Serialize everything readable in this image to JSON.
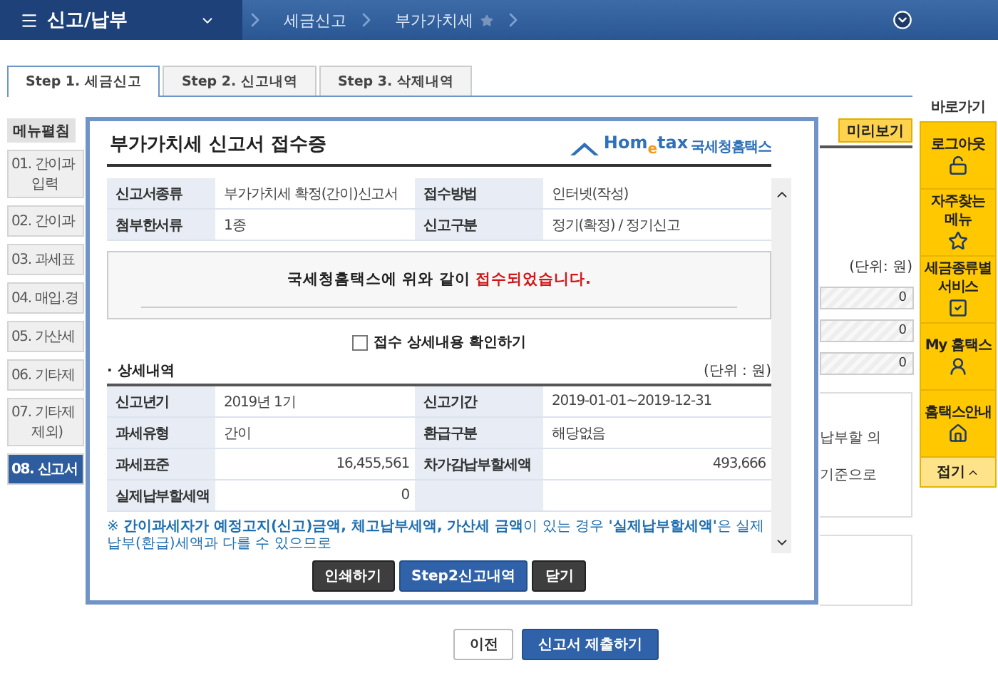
{
  "header": {
    "menu_title": "신고/납부",
    "breadcrumbs": [
      {
        "label": "세금신고"
      },
      {
        "label": "부가가치세",
        "starred": false
      }
    ]
  },
  "tabs": [
    {
      "label": "Step 1. 세금신고",
      "selected": true
    },
    {
      "label": "Step 2. 신고내역",
      "selected": false
    },
    {
      "label": "Step 3. 삭제내역",
      "selected": false
    }
  ],
  "side_menu": {
    "toggle": "메뉴펼침",
    "items": [
      {
        "lines": [
          "01. 간이과",
          "입력"
        ],
        "selected": false
      },
      {
        "lines": [
          "02. 간이과"
        ],
        "selected": false
      },
      {
        "lines": [
          "03. 과세표"
        ],
        "selected": false
      },
      {
        "lines": [
          "04. 매입.경"
        ],
        "selected": false
      },
      {
        "lines": [
          "05. 가산세"
        ],
        "selected": false
      },
      {
        "lines": [
          "06. 기타제"
        ],
        "selected": false
      },
      {
        "lines": [
          "07. 기타제",
          "제외)"
        ],
        "selected": false
      },
      {
        "lines": [
          "08. 신고서"
        ],
        "selected": true
      }
    ]
  },
  "right_panel": {
    "preview_button": "미리보기",
    "unit": "(단위: 원)",
    "fields": [
      {
        "value": "0"
      },
      {
        "value": "0"
      },
      {
        "value": "0"
      }
    ],
    "notes": [
      "납부할 의",
      "기준으로"
    ]
  },
  "quick_bar": {
    "title": "바로가기",
    "items": [
      {
        "lines": [
          "로그아웃"
        ]
      },
      {
        "lines": [
          "자주찾는",
          "메뉴"
        ]
      },
      {
        "lines": [
          "세금종류별",
          "서비스"
        ]
      },
      {
        "lines": [
          "My 홈택스"
        ]
      },
      {
        "lines": [
          "홈택스안내"
        ]
      }
    ],
    "collapse": "접기"
  },
  "dialog": {
    "title": "부가가치세 신고서 접수증",
    "logo": {
      "wordmark": "Hom$_{e}$tax",
      "name": "국세청홈택스"
    },
    "summary_rows": [
      [
        "신고서종류",
        "부가가치세 확정(간이)신고서",
        "접수방법",
        "인터넷(작성)"
      ],
      [
        "첨부한서류",
        "1종",
        "신고구분",
        "정기(확정) / 정기신고"
      ]
    ],
    "message": {
      "text": "국세청홈택스에 위와 같이 ",
      "highlight": "접수되었습니다."
    },
    "confirm_checkbox": {
      "label": "접수 상세내용 확인하기",
      "checked": false
    },
    "details": {
      "title": "· 상세내역",
      "unit": "(단위 : 원)",
      "rows": [
        [
          "신고년기",
          "2019년 1기",
          "신고기간",
          "2019-01-01~2019-12-31"
        ],
        [
          "과세유형",
          "간이",
          "환급구분",
          "해당없음"
        ],
        [
          "과세표준",
          "16,455,561",
          "차가감납부할세액",
          "493,666"
        ],
        [
          "실제납부할세액",
          "0",
          "",
          ""
        ]
      ]
    },
    "note": "※ **간이과세자가 예정고지(신고)금액, 체고납부세액, 가산세 금액**이 있는 경우 **'실제납부할세액'**은 실제 납부(환급)세액과 다를 수 있으므로",
    "buttons": [
      {
        "label": "인쇄하기",
        "kind": "dark"
      },
      {
        "label": "Step2신고내역",
        "kind": "primary"
      },
      {
        "label": "닫기",
        "kind": "dark"
      }
    ]
  },
  "footer_buttons": [
    {
      "label": "이전",
      "kind": "secondary"
    },
    {
      "label": "신고서 제출하기",
      "kind": "primary"
    }
  ]
}
